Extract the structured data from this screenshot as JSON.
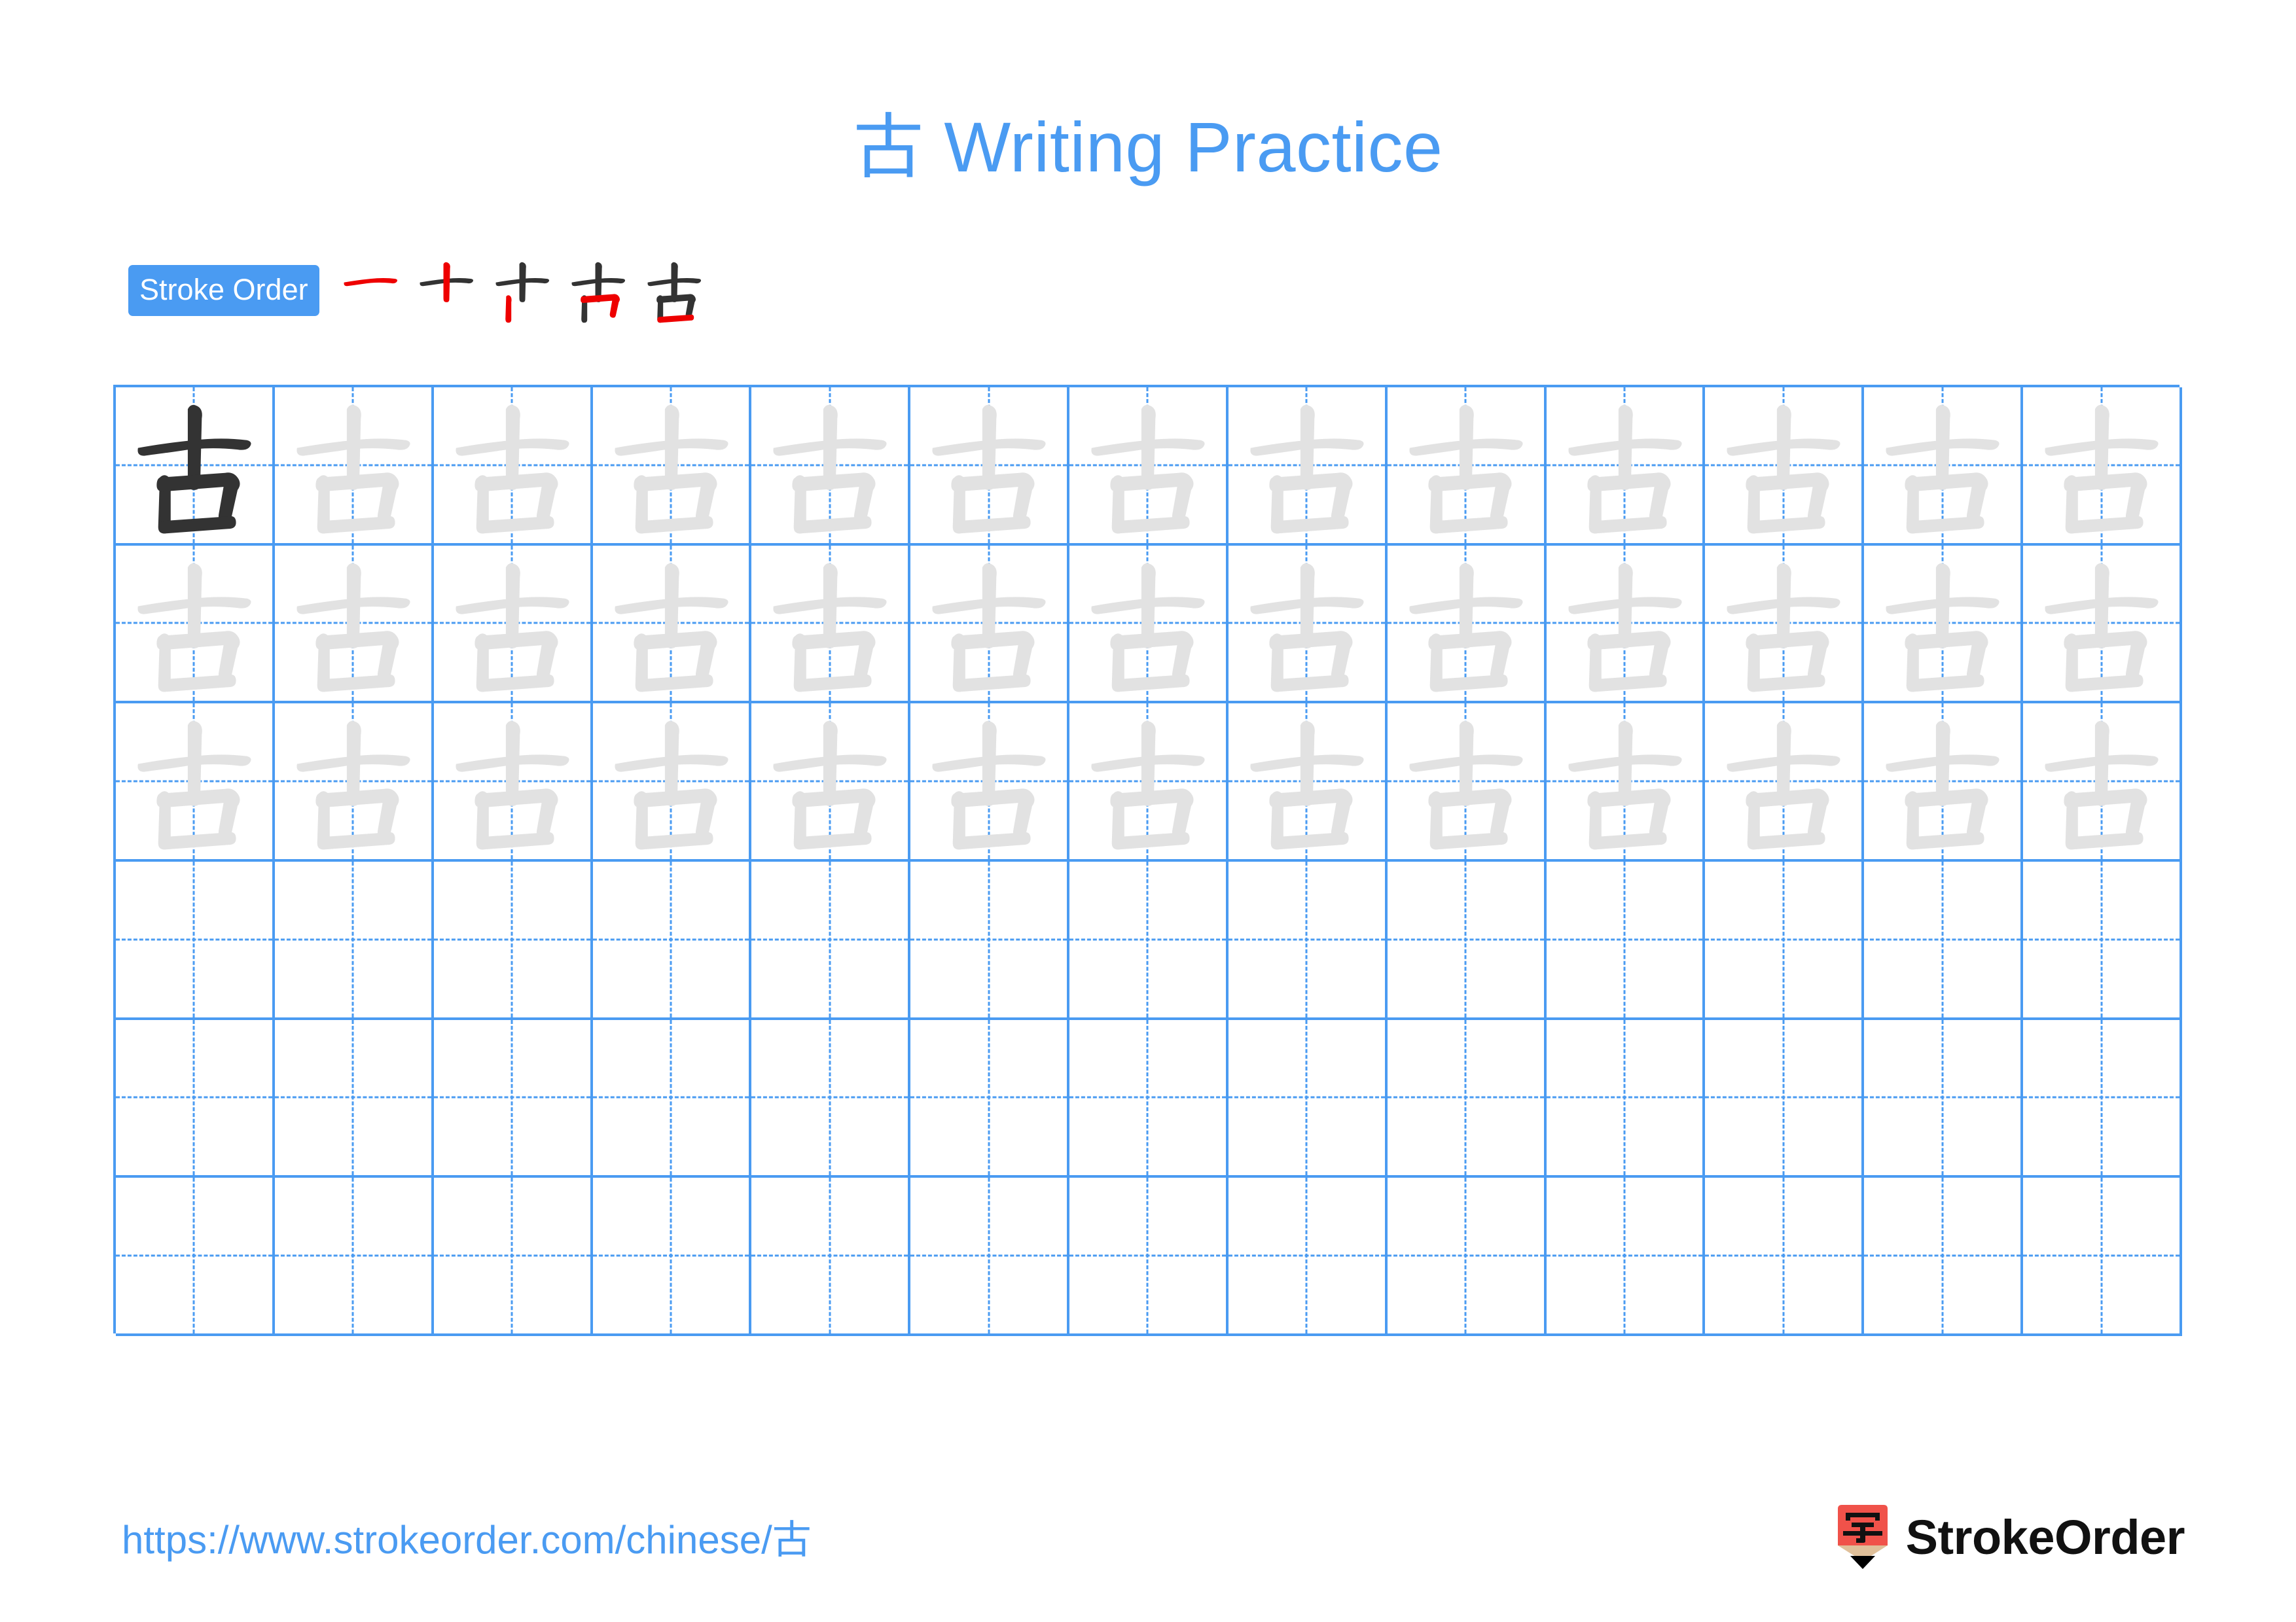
{
  "page": {
    "character": "古",
    "title": "古 Writing Practice",
    "title_character": "古",
    "title_text": "Writing Practice",
    "background_color": "#ffffff",
    "accent_color": "#4a9bf2",
    "stroke_highlight_color": "#ee0000",
    "ink_color": "#333333",
    "trace_color": "#e2e2e2"
  },
  "stroke_order": {
    "badge_label": "Stroke Order",
    "stroke_count": 5,
    "steps": [
      {
        "index": 1,
        "strokes_shown": 1,
        "new_stroke_name": "heng"
      },
      {
        "index": 2,
        "strokes_shown": 2,
        "new_stroke_name": "shu"
      },
      {
        "index": 3,
        "strokes_shown": 3,
        "new_stroke_name": "shu"
      },
      {
        "index": 4,
        "strokes_shown": 4,
        "new_stroke_name": "heng-zhe"
      },
      {
        "index": 5,
        "strokes_shown": 5,
        "new_stroke_name": "heng"
      }
    ]
  },
  "practice_grid": {
    "columns": 13,
    "rows": 6,
    "rows_data": [
      {
        "row": 1,
        "cells": [
          "ink",
          "trace",
          "trace",
          "trace",
          "trace",
          "trace",
          "trace",
          "trace",
          "trace",
          "trace",
          "trace",
          "trace",
          "trace"
        ]
      },
      {
        "row": 2,
        "cells": [
          "trace",
          "trace",
          "trace",
          "trace",
          "trace",
          "trace",
          "trace",
          "trace",
          "trace",
          "trace",
          "trace",
          "trace",
          "trace"
        ]
      },
      {
        "row": 3,
        "cells": [
          "trace",
          "trace",
          "trace",
          "trace",
          "trace",
          "trace",
          "trace",
          "trace",
          "trace",
          "trace",
          "trace",
          "trace",
          "trace"
        ]
      },
      {
        "row": 4,
        "cells": [
          "empty",
          "empty",
          "empty",
          "empty",
          "empty",
          "empty",
          "empty",
          "empty",
          "empty",
          "empty",
          "empty",
          "empty",
          "empty"
        ]
      },
      {
        "row": 5,
        "cells": [
          "empty",
          "empty",
          "empty",
          "empty",
          "empty",
          "empty",
          "empty",
          "empty",
          "empty",
          "empty",
          "empty",
          "empty",
          "empty"
        ]
      },
      {
        "row": 6,
        "cells": [
          "empty",
          "empty",
          "empty",
          "empty",
          "empty",
          "empty",
          "empty",
          "empty",
          "empty",
          "empty",
          "empty",
          "empty",
          "empty"
        ]
      }
    ]
  },
  "footer": {
    "url": "https://www.strokeorder.com/chinese/古",
    "logo_text": "StrokeOrder",
    "logo_character": "字",
    "logo_body_color": "#f0524a",
    "logo_wood_color": "#e0c09a"
  }
}
